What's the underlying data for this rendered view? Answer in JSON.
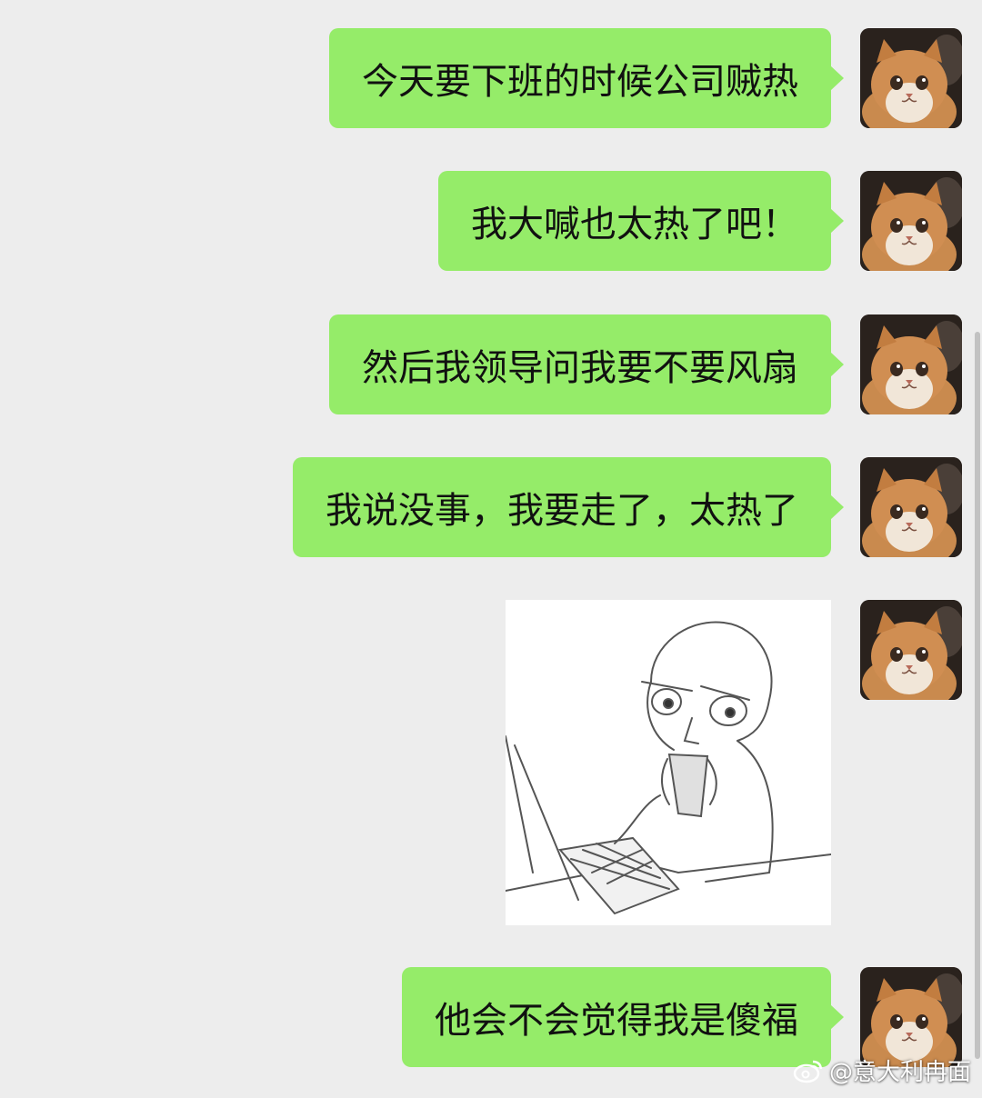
{
  "chat": {
    "messages": [
      {
        "type": "text",
        "text": "今天要下班的时候公司贼热",
        "sender": "self"
      },
      {
        "type": "text",
        "text": "我大喊也太热了吧！",
        "sender": "self"
      },
      {
        "type": "text",
        "text": "然后我领导问我要不要风扇",
        "sender": "self"
      },
      {
        "type": "text",
        "text": "我说没事，我要走了，太热了",
        "sender": "self"
      },
      {
        "type": "sticker",
        "description": "drawing-person-at-laptop-drinking-sticker",
        "sender": "self"
      },
      {
        "type": "text",
        "text": "他会不会觉得我是傻福",
        "sender": "self"
      }
    ]
  },
  "avatar": {
    "icon": "cat-avatar-icon"
  },
  "colors": {
    "background": "#ededed",
    "bubble_self": "#95ec69",
    "text": "#111111"
  },
  "watermark": {
    "icon": "weibo-logo-icon",
    "text": "@意大利冉面"
  }
}
